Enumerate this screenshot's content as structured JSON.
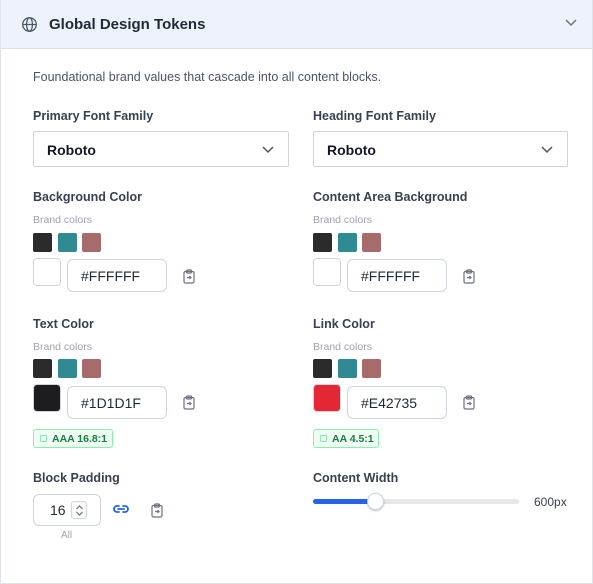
{
  "header": {
    "title": "Global Design Tokens",
    "icon": "globe-icon",
    "collapse_icon": "chevron-down-icon"
  },
  "description": "Foundational brand values that cascade into all content blocks.",
  "fonts": {
    "primary": {
      "label": "Primary Font Family",
      "value": "Roboto"
    },
    "heading": {
      "label": "Heading Font Family",
      "value": "Roboto"
    }
  },
  "brand_colors_label": "Brand colors",
  "brand_colors": [
    "#2b2b2b",
    "#2f8a93",
    "#a76b6b"
  ],
  "colors": {
    "background": {
      "label": "Background Color",
      "value": "#FFFFFF",
      "swatch": "#ffffff"
    },
    "content_bg": {
      "label": "Content Area Background",
      "value": "#FFFFFF",
      "swatch": "#ffffff"
    },
    "text": {
      "label": "Text Color",
      "value": "#1D1D1F",
      "swatch": "#1d1d1f",
      "contrast": "AAA 16.8:1"
    },
    "link": {
      "label": "Link Color",
      "value": "#E42735",
      "swatch": "#e42735",
      "contrast": "AA 4.5:1"
    }
  },
  "padding": {
    "label": "Block Padding",
    "value": "16",
    "scope": "All"
  },
  "content_width": {
    "label": "Content Width",
    "value_text": "600px",
    "fraction": 0.3
  }
}
